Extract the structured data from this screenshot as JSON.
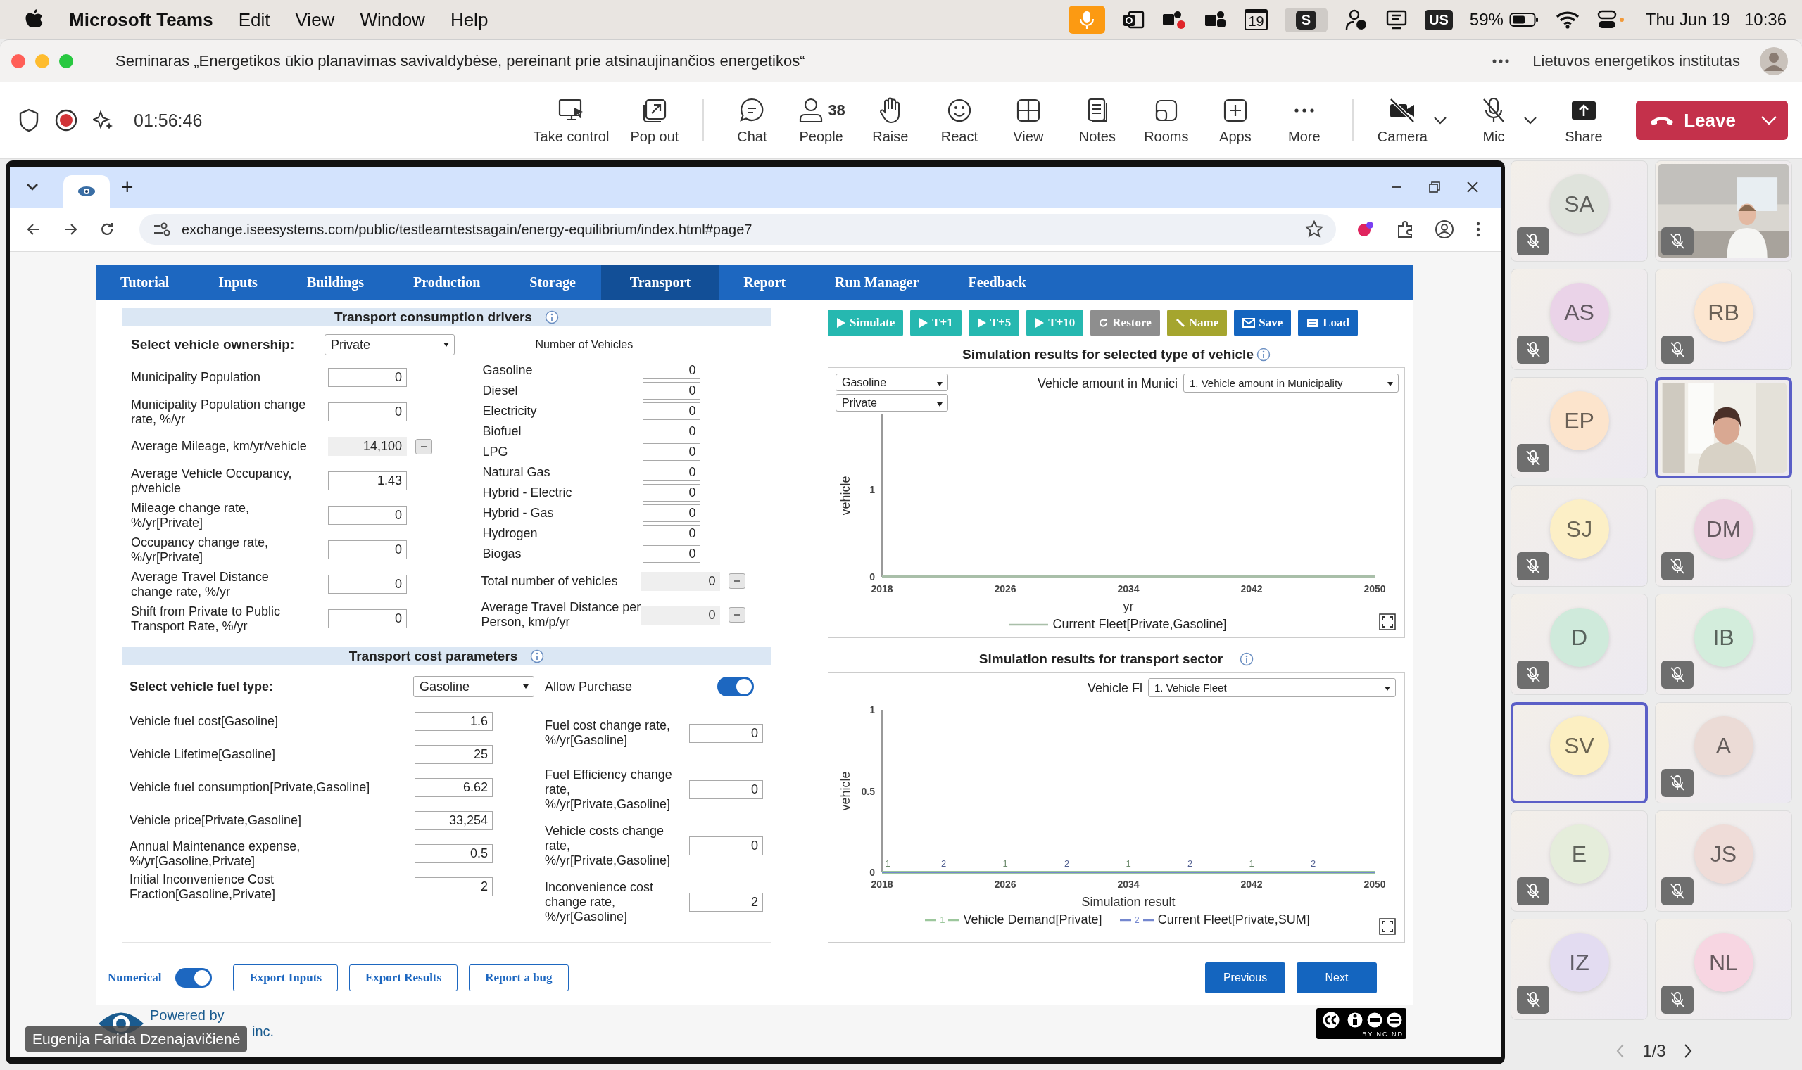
{
  "menu_bar": {
    "app_name": "Microsoft Teams",
    "menus": [
      "Edit",
      "View",
      "Window",
      "Help"
    ],
    "status_items": [
      {
        "kind": "mic"
      },
      {
        "kind": "mail"
      },
      {
        "kind": "chat"
      },
      {
        "kind": "people"
      },
      {
        "kind": "calendar",
        "text": "19"
      },
      {
        "kind": "letter",
        "text": "S"
      },
      {
        "kind": "lock"
      },
      {
        "kind": "display"
      },
      {
        "kind": "input",
        "text": "US"
      },
      {
        "kind": "battery",
        "text": "59%"
      },
      {
        "kind": "wifi"
      },
      {
        "kind": "switches"
      }
    ],
    "date": "Thu Jun 19",
    "time": "10:36"
  },
  "meeting": {
    "title": "Seminaras „Energetikos ūkio planavimas savivaldybėse, pereinant prie atsinaujinančios energetikos“",
    "organization": "Lietuvos energetikos institutas",
    "timer": "01:56:46",
    "toolbar": [
      {
        "kind": "take-control",
        "label": "Take control"
      },
      {
        "kind": "pop-out",
        "label": "Pop out"
      },
      {
        "kind": "chat",
        "label": "Chat"
      },
      {
        "kind": "people",
        "label": "People",
        "count": "38"
      },
      {
        "kind": "raise",
        "label": "Raise"
      },
      {
        "kind": "react",
        "label": "React"
      },
      {
        "kind": "view",
        "label": "View"
      },
      {
        "kind": "notes",
        "label": "Notes"
      },
      {
        "kind": "rooms",
        "label": "Rooms"
      },
      {
        "kind": "apps",
        "label": "Apps"
      },
      {
        "kind": "more",
        "label": "More"
      },
      {
        "kind": "camera",
        "label": "Camera"
      },
      {
        "kind": "mic",
        "label": "Mic"
      },
      {
        "kind": "share",
        "label": "Share"
      }
    ],
    "leave": "Leave"
  },
  "browser": {
    "new_tab": "+",
    "url": "exchange.iseesystems.com/public/testlearntestsagain/energy-equilibrium/index.html#page7"
  },
  "app": {
    "tabs": [
      {
        "label": "Tutorial",
        "selected": false
      },
      {
        "label": "Inputs",
        "selected": false
      },
      {
        "label": "Buildings",
        "selected": false
      },
      {
        "label": "Production",
        "selected": false
      },
      {
        "label": "Storage",
        "selected": false
      },
      {
        "label": "Transport",
        "selected": true
      },
      {
        "label": "Report",
        "selected": false
      },
      {
        "label": "Run Manager",
        "selected": false
      },
      {
        "label": "Feedback",
        "selected": false
      }
    ],
    "drivers": {
      "title": "Transport consumption drivers",
      "ownership_label": "Select vehicle ownership:",
      "ownership": "Private",
      "vehicles_heading": "Number of Vehicles",
      "inputs": [
        {
          "label": "Municipality Population",
          "value": "0",
          "readonly": false
        },
        {
          "label": "Municipality Population change rate, %/yr",
          "value": "0",
          "readonly": false
        },
        {
          "label": "Average Mileage, km/yr/vehicle",
          "value": "14,100",
          "readonly": true
        },
        {
          "label": "Average Vehicle Occupancy, p/vehicle",
          "value": "1.43",
          "readonly": false
        },
        {
          "label": "Mileage change rate, %/yr[Private]",
          "value": "0",
          "readonly": false
        },
        {
          "label": "Occupancy change rate, %/yr[Private]",
          "value": "0",
          "readonly": false
        },
        {
          "label": "Average Travel Distance change rate, %/yr",
          "value": "0",
          "readonly": false
        },
        {
          "label": "Shift from Private to Public Transport Rate, %/yr",
          "value": "0",
          "readonly": false
        }
      ],
      "vehicles": [
        {
          "label": "Gasoline",
          "value": "0"
        },
        {
          "label": "Diesel",
          "value": "0"
        },
        {
          "label": "Electricity",
          "value": "0"
        },
        {
          "label": "Biofuel",
          "value": "0"
        },
        {
          "label": "LPG",
          "value": "0"
        },
        {
          "label": "Natural Gas",
          "value": "0"
        },
        {
          "label": "Hybrid - Electric",
          "value": "0"
        },
        {
          "label": "Hybrid - Gas",
          "value": "0"
        },
        {
          "label": "Hydrogen",
          "value": "0"
        },
        {
          "label": "Biogas",
          "value": "0"
        }
      ],
      "totals": [
        {
          "label": "Total number of vehicles",
          "value": "0"
        },
        {
          "label": "Average Travel Distance per Person, km/p/yr",
          "value": "0"
        }
      ]
    },
    "costs": {
      "title": "Transport cost parameters",
      "fuel_label": "Select vehicle fuel type:",
      "fuel": "Gasoline",
      "allow_purchase": {
        "label": "Allow Purchase",
        "on": true
      },
      "left": [
        {
          "label": "Vehicle fuel cost[Gasoline]",
          "value": "1.6"
        },
        {
          "label": "Vehicle Lifetime[Gasoline]",
          "value": "25"
        },
        {
          "label": "Vehicle fuel consumption[Private,Gasoline]",
          "value": "6.62"
        },
        {
          "label": "Vehicle price[Private,Gasoline]",
          "value": "33,254"
        },
        {
          "label": "Annual Maintenance expense, %/yr[Gasoline,Private]",
          "value": "0.5"
        },
        {
          "label": "Initial Inconvenience Cost Fraction[Gasoline,Private]",
          "value": "2"
        }
      ],
      "right": [
        {
          "label": "Fuel cost change rate, %/yr[Gasoline]",
          "value": "0"
        },
        {
          "label": "Fuel Efficiency change rate, %/yr[Private,Gasoline]",
          "value": "0"
        },
        {
          "label": "Vehicle costs change rate, %/yr[Private,Gasoline]",
          "value": "0"
        },
        {
          "label": "Inconvenience cost change rate, %/yr[Gasoline]",
          "value": "2"
        }
      ]
    },
    "actions": [
      {
        "kind": "play",
        "label": "Simulate"
      },
      {
        "kind": "play",
        "label": "T+1"
      },
      {
        "kind": "play",
        "label": "T+5"
      },
      {
        "kind": "play",
        "label": "T+10"
      },
      {
        "kind": "restore",
        "label": "Restore"
      },
      {
        "kind": "name",
        "label": "Name"
      },
      {
        "kind": "save",
        "label": "Save"
      },
      {
        "kind": "load",
        "label": "Load"
      }
    ],
    "vehicle_chart": {
      "selects": [
        "Gasoline",
        "Private"
      ],
      "variable_label": "Vehicle amount in Munici",
      "variable": "1. Vehicle amount in Municipality",
      "chart_data": {
        "type": "line",
        "title": "Simulation results for selected type of vehicle",
        "xlabel": "yr",
        "ylabel": "vehicle",
        "x": [
          2018,
          2050
        ],
        "legend": "bottom",
        "series": [
          {
            "name": "Current Fleet[Private,Gasoline]",
            "color": "#a9bfa9",
            "values": [
              0,
              0
            ]
          }
        ],
        "xlim": [
          2018,
          2050
        ],
        "ylim": [
          0,
          1.86
        ],
        "xticks": [
          2018,
          2026,
          2034,
          2042,
          2050
        ],
        "yticks": [
          0,
          1
        ]
      }
    },
    "sector_chart": {
      "variable_label": "Vehicle Fl",
      "variable": "1. Vehicle Fleet",
      "series_markers": [
        [
          "1",
          "1",
          "1",
          "1"
        ],
        [
          "2",
          "2",
          "2",
          "2"
        ]
      ],
      "legend_markers": [
        "1",
        "2"
      ],
      "chart_data": {
        "type": "line",
        "title": "Simulation results for transport sector",
        "xlabel": "Simulation result",
        "ylabel": "vehicle",
        "x": [
          2018,
          2022,
          2026,
          2030,
          2034,
          2038,
          2042,
          2046,
          2050
        ],
        "legend": "bottom",
        "series": [
          {
            "name": "Vehicle Demand[Private]",
            "color": "#9cc79c",
            "values": [
              0,
              0,
              0,
              0,
              0,
              0,
              0,
              0,
              0
            ]
          },
          {
            "name": "Current Fleet[Private,SUM]",
            "color": "#7487cf",
            "values": [
              0,
              0,
              0,
              0,
              0,
              0,
              0,
              0,
              0
            ]
          }
        ],
        "xlim": [
          2018,
          2050
        ],
        "ylim": [
          0,
          1
        ],
        "xticks": [
          2018,
          2026,
          2034,
          2042,
          2050
        ],
        "yticks": [
          0,
          0.5,
          1
        ]
      }
    },
    "numerical": {
      "label": "Numerical",
      "on": true
    },
    "bottom_buttons": [
      "Export Inputs",
      "Export Results",
      "Report a bug"
    ],
    "nav_buttons": [
      "Previous",
      "Next"
    ],
    "footer": {
      "powered": "Powered by",
      "company_tail": "inc.",
      "license": "BY NC ND"
    }
  },
  "presenter_name": "Eugenija Farida Dzenajavičienė",
  "participants": [
    {
      "kind": "avatar",
      "initials": "SA",
      "color": "#dfe3dc",
      "muted": true,
      "speaking": false
    },
    {
      "kind": "video",
      "muted": true,
      "speaking": false
    },
    {
      "kind": "avatar",
      "initials": "AS",
      "color": "#ead3e8",
      "muted": true,
      "speaking": false
    },
    {
      "kind": "avatar",
      "initials": "RB",
      "color": "#fce6d0",
      "muted": true,
      "speaking": false
    },
    {
      "kind": "avatar",
      "initials": "EP",
      "color": "#fce4cc",
      "muted": true,
      "speaking": false
    },
    {
      "kind": "video",
      "muted": false,
      "speaking": true
    },
    {
      "kind": "avatar",
      "initials": "SJ",
      "color": "#fcefc6",
      "muted": true,
      "speaking": false
    },
    {
      "kind": "avatar",
      "initials": "DM",
      "color": "#edd3e1",
      "muted": true,
      "speaking": false
    },
    {
      "kind": "avatar",
      "initials": "D",
      "color": "#cfeadb",
      "muted": true,
      "speaking": false
    },
    {
      "kind": "avatar",
      "initials": "IB",
      "color": "#d3eddc",
      "muted": true,
      "speaking": false
    },
    {
      "kind": "avatar",
      "initials": "SV",
      "color": "#fcefc2",
      "muted": false,
      "speaking": true
    },
    {
      "kind": "avatar",
      "initials": "A",
      "color": "#ebdbd6",
      "muted": true,
      "speaking": false
    },
    {
      "kind": "avatar",
      "initials": "E",
      "color": "#e5eddb",
      "muted": true,
      "speaking": false
    },
    {
      "kind": "avatar",
      "initials": "JS",
      "color": "#efdcd8",
      "muted": true,
      "speaking": false
    },
    {
      "kind": "avatar",
      "initials": "IZ",
      "color": "#e3dcf1",
      "muted": true,
      "speaking": false
    },
    {
      "kind": "avatar",
      "initials": "NL",
      "color": "#f7d6e2",
      "muted": true,
      "speaking": false
    }
  ],
  "pager": "1/3"
}
